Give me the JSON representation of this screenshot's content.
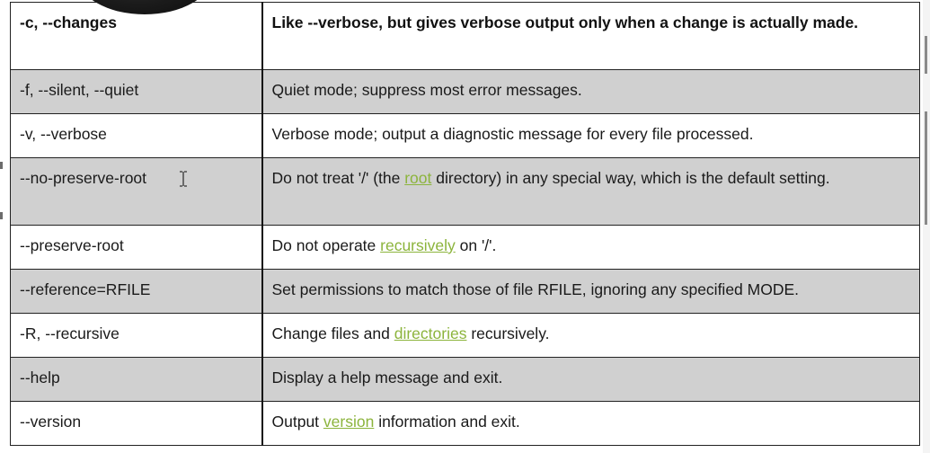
{
  "options_table": {
    "rows": [
      {
        "option": "-c, --changes",
        "description": [
          {
            "text": "Like --verbose, but gives verbose output only when a change is actually made."
          }
        ],
        "header": true,
        "shaded": false
      },
      {
        "option": "-f, --silent, --quiet",
        "description": [
          {
            "text": "Quiet mode; suppress most error messages."
          }
        ],
        "shaded": true
      },
      {
        "option": "-v, --verbose",
        "description": [
          {
            "text": "Verbose mode; output a diagnostic message for every file processed."
          }
        ],
        "shaded": false
      },
      {
        "option": "--no-preserve-root",
        "description": [
          {
            "text": "Do not treat '/' (the "
          },
          {
            "text": "root",
            "link": true
          },
          {
            "text": " directory) in any special way, which is the default setting."
          }
        ],
        "shaded": true
      },
      {
        "option": "--preserve-root",
        "description": [
          {
            "text": "Do not operate "
          },
          {
            "text": "recursively",
            "link": true
          },
          {
            "text": " on '/'."
          }
        ],
        "shaded": false
      },
      {
        "option": "--reference=RFILE",
        "description": [
          {
            "text": "Set permissions to match those of file RFILE, ignoring any specified MODE."
          }
        ],
        "shaded": true
      },
      {
        "option": "-R, --recursive",
        "description": [
          {
            "text": "Change files and "
          },
          {
            "text": "directories",
            "link": true
          },
          {
            "text": " recursively."
          }
        ],
        "shaded": false
      },
      {
        "option": "--help",
        "description": [
          {
            "text": "Display a help message and exit."
          }
        ],
        "shaded": true
      },
      {
        "option": "--version",
        "description": [
          {
            "text": "Output "
          },
          {
            "text": "version",
            "link": true
          },
          {
            "text": " information and exit."
          }
        ],
        "shaded": false
      }
    ]
  },
  "colors": {
    "link": "#8cb43c",
    "shaded_row": "#d0d0d0",
    "border": "#222222",
    "text": "#1a1a1a"
  },
  "cursor_icon": "text-ibeam-cursor-icon"
}
